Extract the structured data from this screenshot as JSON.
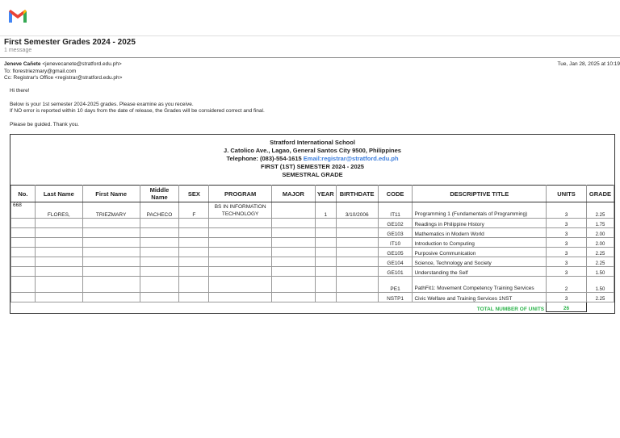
{
  "email": {
    "subject": "First Semester Grades 2024 - 2025",
    "count": "1 message",
    "from_name": "Jeneve Cañete",
    "from_email": "<jenevecanete@stratford.edu.ph>",
    "to": "To: florestriezmary@gmail.com",
    "cc": "Cc: Registrar's Office <registrar@stratford.edu.ph>",
    "date": "Tue, Jan 28, 2025 at 10:19",
    "body": [
      "Hi there!",
      "Below is your 1st semester 2024-2025 grades. Please examine as you receive.",
      "If NO error is reported within 10 days from the date of release, the Grades will be considered correct and final.",
      "Please be guided. Thank you."
    ]
  },
  "sheet": {
    "school": "Stratford International School",
    "address": "J. Catolico Ave., Lagao, General Santos City 9500, Philippines",
    "telephone": "Telephone: (083)-554-1615",
    "email": "Email:registrar@stratford.edu.ph",
    "semester": "FIRST (1ST) SEMESTER 2024 - 2025",
    "grade_title": "SEMESTRAL GRADE",
    "headers": [
      "No.",
      "Last Name",
      "First Name",
      "Middle Name",
      "SEX",
      "PROGRAM",
      "MAJOR",
      "YEAR",
      "BIRTHDATE",
      "CODE",
      "DESCRIPTIVE TITLE",
      "UNITS",
      "GRADE"
    ],
    "student": {
      "no": "668",
      "last": "FLORES,",
      "first": "TRIEZMARY",
      "middle": "PACHECO",
      "sex": "F",
      "program": "BS IN INFORMATION TECHNOLOGY",
      "major": "",
      "year": "1",
      "birthdate": "3/10/2006"
    },
    "courses": [
      {
        "code": "IT11",
        "title": "Programming 1 (Fundamentals of Programming)",
        "units": "3",
        "grade": "2.25"
      },
      {
        "code": "GE102",
        "title": "Readings in Philippine History",
        "units": "3",
        "grade": "1.75"
      },
      {
        "code": "GE103",
        "title": "Mathematics in Modern World",
        "units": "3",
        "grade": "2.00"
      },
      {
        "code": "IT10",
        "title": "Introduction to Computing",
        "units": "3",
        "grade": "2.00"
      },
      {
        "code": "GE105",
        "title": "Purposive Communication",
        "units": "3",
        "grade": "2.25"
      },
      {
        "code": "GE104",
        "title": "Science, Technology and Society",
        "units": "3",
        "grade": "2.25"
      },
      {
        "code": "GE101",
        "title": "Understanding the Self",
        "units": "3",
        "grade": "1.50"
      },
      {
        "code": "PE1",
        "title": "PathFit1: Movement Competency Training Services",
        "units": "2",
        "grade": "1.50"
      },
      {
        "code": "NSTP1",
        "title": "Civic Welfare and Training Services 1NST",
        "units": "3",
        "grade": "2.25"
      }
    ],
    "total_label": "TOTAL NUMBER OF UNITS",
    "total_units": "26"
  }
}
